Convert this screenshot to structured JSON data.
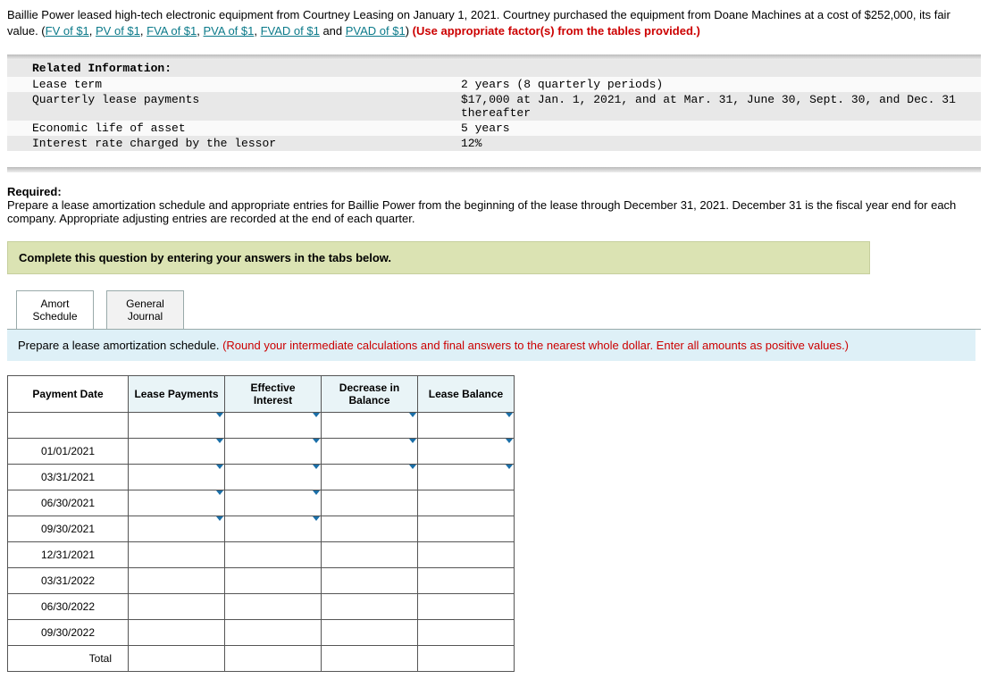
{
  "intro": {
    "text1": "Baillie Power leased high-tech electronic equipment from Courtney Leasing on January 1, 2021. Courtney purchased the equipment from Doane Machines at a cost of $252,000, its fair value. (",
    "links": [
      "FV of $1",
      "PV of $1",
      "FVA of $1",
      "PVA of $1",
      "FVAD of $1",
      "PVAD of $1"
    ],
    "sep": ", ",
    "and": " and ",
    "close": ") ",
    "red": "(Use appropriate factor(s) from the tables provided.)"
  },
  "info": {
    "header": "Related Information:",
    "rows": [
      {
        "label": "Lease term",
        "value": "2 years (8 quarterly periods)"
      },
      {
        "label": "Quarterly lease payments",
        "value": "$17,000 at Jan. 1, 2021, and at Mar. 31, June 30, Sept. 30, and Dec. 31 thereafter"
      },
      {
        "label": "Economic life of asset",
        "value": "5 years"
      },
      {
        "label": "Interest rate charged by the lessor",
        "value": "12%"
      }
    ]
  },
  "required": {
    "title": "Required:",
    "body": "Prepare a lease amortization schedule and appropriate entries for Baillie Power from the beginning of the lease through December 31, 2021. December 31 is the fiscal year end for each company. Appropriate adjusting entries are recorded at the end of each quarter."
  },
  "instruction": "Complete this question by entering your answers in the tabs below.",
  "tabs": [
    {
      "line1": "Amort",
      "line2": "Schedule"
    },
    {
      "line1": "General",
      "line2": "Journal"
    }
  ],
  "tabPanelInstr": {
    "plain": "Prepare a lease amortization schedule. ",
    "red": "(Round your intermediate calculations and final answers to the nearest whole dollar. Enter all amounts as positive values.)"
  },
  "schedule": {
    "headers": [
      "Payment Date",
      "Lease Payments",
      "Effective Interest",
      "Decrease in Balance",
      "Lease Balance"
    ],
    "dates": [
      "",
      "01/01/2021",
      "03/31/2021",
      "06/30/2021",
      "09/30/2021",
      "12/31/2021",
      "03/31/2022",
      "06/30/2022",
      "09/30/2022"
    ],
    "totalLabel": "Total"
  }
}
